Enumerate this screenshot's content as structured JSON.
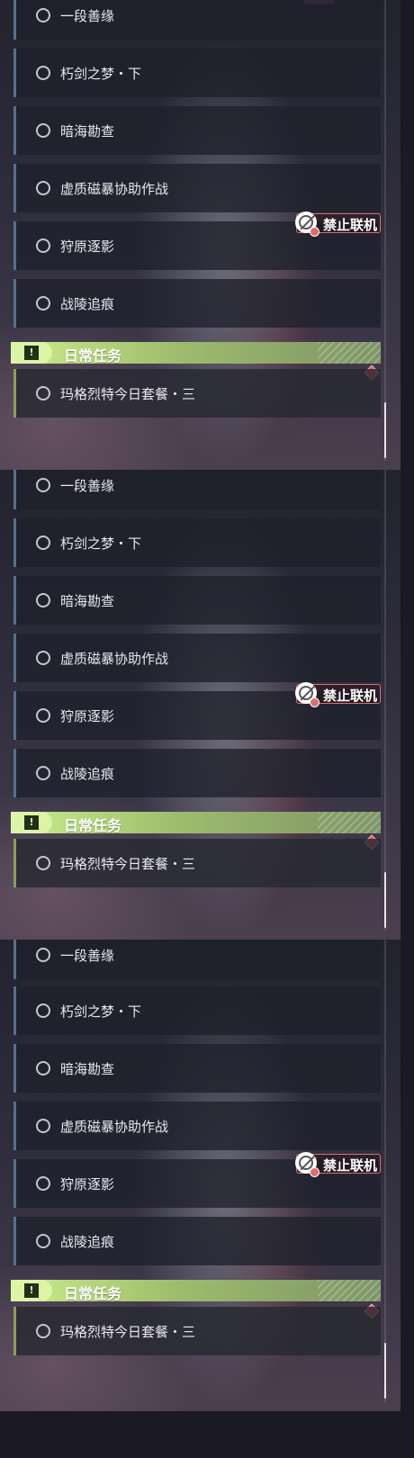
{
  "panels": [
    {
      "quests": [
        "一段善缘",
        "朽剑之梦・下",
        "暗海勘查",
        "虚质磁暴协助作战",
        "狩原逐影",
        "战陵追痕"
      ],
      "badge_label": "禁止联机",
      "section": {
        "title": "日常任务",
        "tab_icon": "!",
        "quests": [
          "玛格烈特今日套餐・三"
        ]
      }
    },
    {
      "quests": [
        "一段善缘",
        "朽剑之梦・下",
        "暗海勘查",
        "虚质磁暴协助作战",
        "狩原逐影",
        "战陵追痕"
      ],
      "badge_label": "禁止联机",
      "section": {
        "title": "日常任务",
        "tab_icon": "!",
        "quests": [
          "玛格烈特今日套餐・三"
        ]
      }
    },
    {
      "quests": [
        "一段善缘",
        "朽剑之梦・下",
        "暗海勘查",
        "虚质磁暴协助作战",
        "狩原逐影",
        "战陵追痕"
      ],
      "badge_label": "禁止联机",
      "section": {
        "title": "日常任务",
        "tab_icon": "!",
        "quests": [
          "玛格烈特今日套餐・三"
        ]
      }
    }
  ],
  "icons": {
    "quest_status": "circle-outline-icon",
    "section_tab": "exclamation-icon",
    "badge": "no-multiplayer-icon",
    "alert": "red-diamond-icon"
  },
  "colors": {
    "section_accent": "#c9ee89",
    "quest_bar": "#56708a",
    "daily_bar": "#8aa05a",
    "badge_border": "#e06d6d",
    "alert": "#e05468"
  }
}
